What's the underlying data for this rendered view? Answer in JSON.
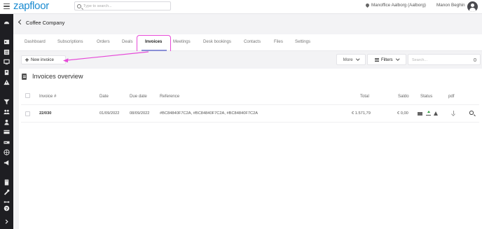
{
  "app": {
    "logo": "zapfloor"
  },
  "topbar": {
    "search_placeholder": "Type to search...",
    "location": "Manoffice Aalborg (Aalborg)",
    "user_name": "Manon Beghin"
  },
  "page": {
    "company": "Coffee Company"
  },
  "tabs": [
    {
      "label": "Dashboard"
    },
    {
      "label": "Subscriptions"
    },
    {
      "label": "Orders"
    },
    {
      "label": "Deals"
    },
    {
      "label": "Invoices",
      "active": true
    },
    {
      "label": "Meetings"
    },
    {
      "label": "Desk bookings"
    },
    {
      "label": "Contacts"
    },
    {
      "label": "Files"
    },
    {
      "label": "Settings"
    }
  ],
  "toolbar": {
    "new_invoice_label": "New invoice",
    "more_label": "More",
    "filters_label": "Filters",
    "search_placeholder": "Search..."
  },
  "overview": {
    "title": "Invoices overview",
    "columns": {
      "invoice": "Invoice #",
      "date": "Date",
      "due_date": "Due date",
      "reference": "Reference",
      "total": "Total",
      "saldo": "Saldo",
      "status": "Status",
      "pdf": "pdf"
    },
    "rows": [
      {
        "invoice": "22/030",
        "date": "01/09/2022",
        "due_date": "08/09/2022",
        "reference": "#BC84840F7C2A, #BC84840F7C2A, #BC84840F7C2A",
        "total": "€ 1.571,79",
        "saldo": "€ 0,00"
      }
    ]
  },
  "colors": {
    "brand": "#1a8bd1",
    "sidebar": "#1e1e22",
    "annotation": "#e64ad8"
  }
}
